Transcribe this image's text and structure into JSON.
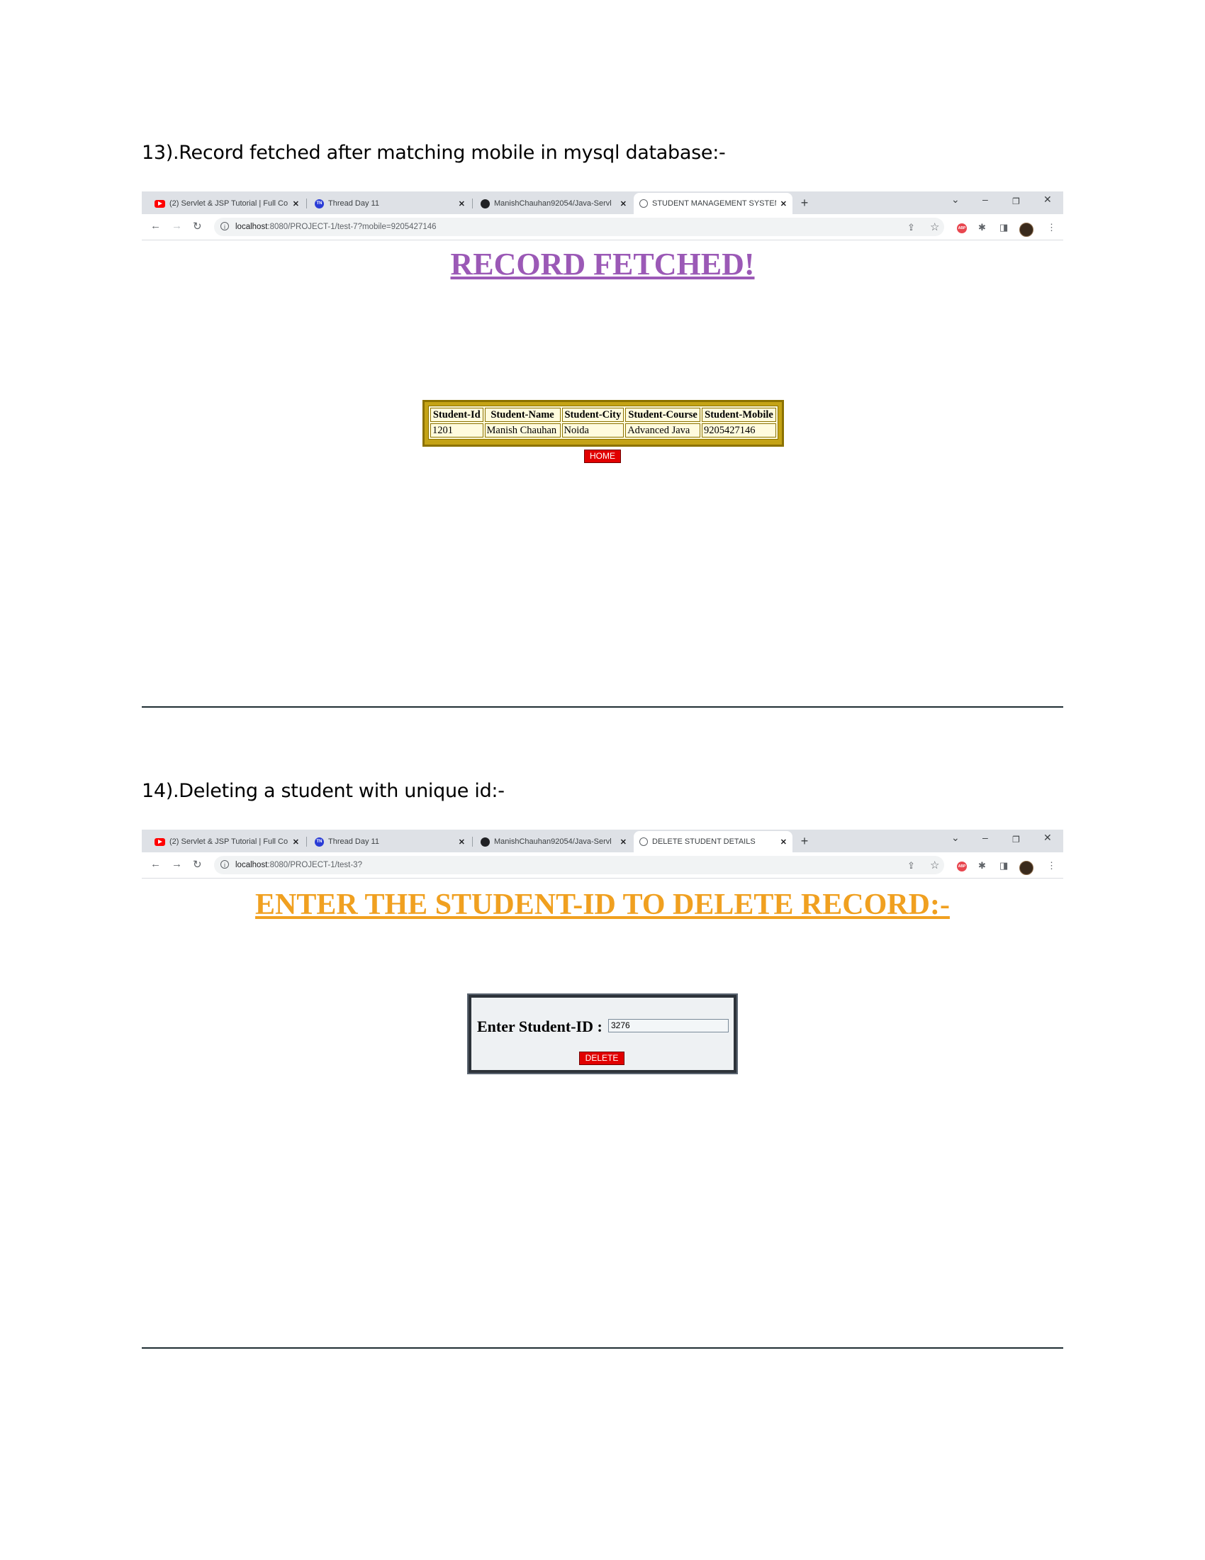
{
  "section13": {
    "heading": "13).Record fetched after matching mobile in mysql database:-",
    "browser": {
      "tabs": [
        {
          "title": "(2) Servlet & JSP Tutorial | Full Co",
          "favicon": "youtube-icon"
        },
        {
          "title": "Thread Day 11",
          "favicon": "thread-icon"
        },
        {
          "title": "ManishChauhan92054/Java-Servl",
          "favicon": "github-icon"
        },
        {
          "title": "STUDENT MANAGEMENT SYSTEM",
          "favicon": "globe-icon",
          "active": true
        }
      ],
      "url_host": "localhost",
      "url_rest": ":8080/PROJECT-1/test-7?mobile=9205427146"
    },
    "page": {
      "title": "RECORD FETCHED!",
      "title_color": "#9b59b6",
      "table": {
        "headers": [
          "Student-Id",
          "Student-Name",
          "Student-City",
          "Student-Course",
          "Student-Mobile"
        ],
        "rows": [
          [
            "1201",
            "Manish Chauhan",
            "Noida",
            "Advanced Java",
            "9205427146"
          ]
        ]
      },
      "home_button": "HOME"
    }
  },
  "section14": {
    "heading": "14).Deleting a student with unique id:-",
    "browser": {
      "tabs": [
        {
          "title": "(2) Servlet & JSP Tutorial | Full Co",
          "favicon": "youtube-icon"
        },
        {
          "title": "Thread Day 11",
          "favicon": "thread-icon"
        },
        {
          "title": "ManishChauhan92054/Java-Servl",
          "favicon": "github-icon"
        },
        {
          "title": "DELETE STUDENT DETAILS",
          "favicon": "globe-icon",
          "active": true
        }
      ],
      "url_host": "localhost",
      "url_rest": ":8080/PROJECT-1/test-3?"
    },
    "page": {
      "title": "ENTER THE STUDENT-ID TO DELETE RECORD:-",
      "title_color": "#f0a020",
      "label": "Enter Student-ID :",
      "input_value": "3276",
      "delete_button": "DELETE"
    }
  },
  "colors": {
    "delete_red": "#e10000",
    "table_gold": "#c4a316"
  }
}
